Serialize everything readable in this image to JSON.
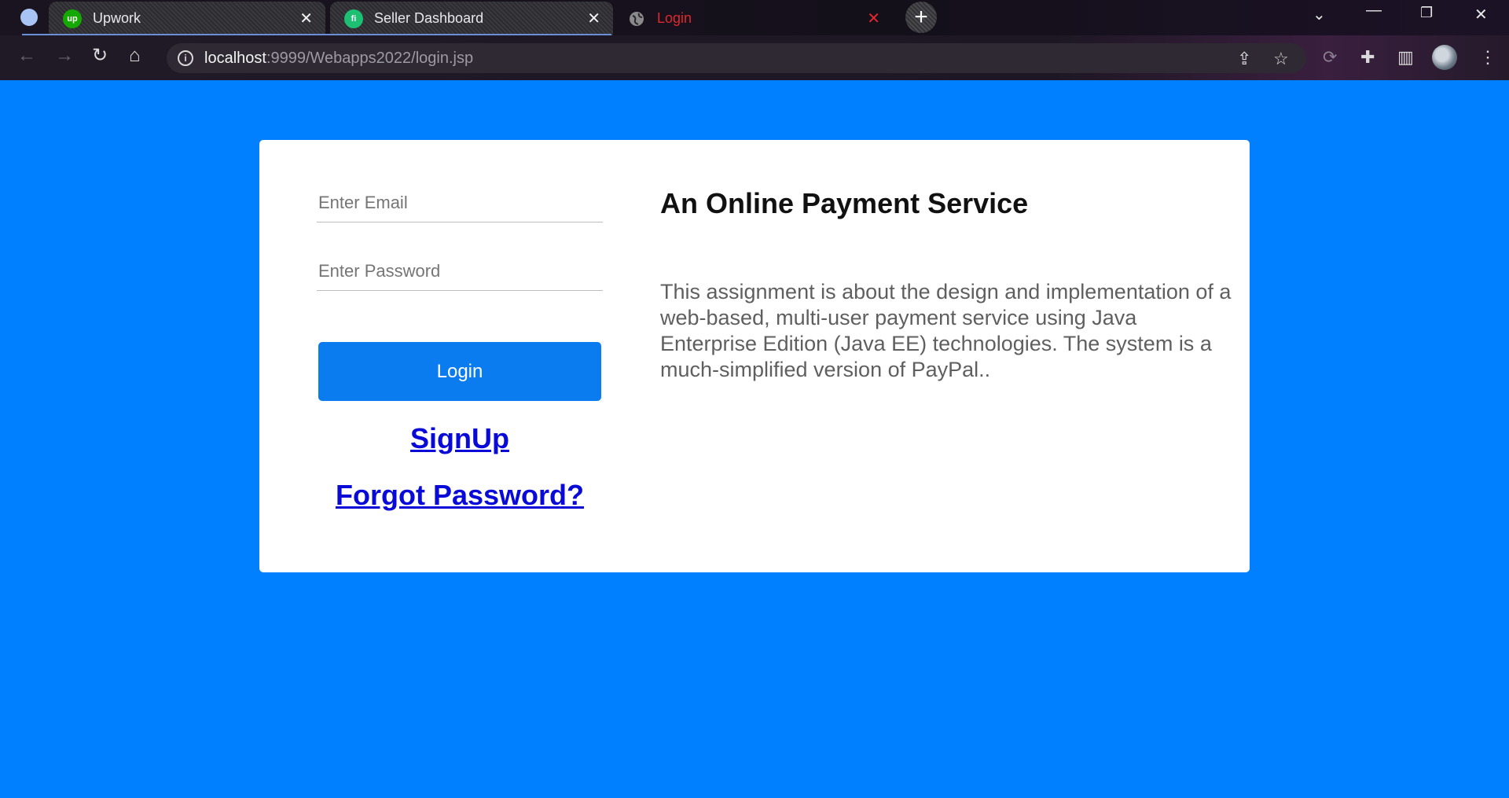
{
  "browser": {
    "tabs": [
      {
        "label": "Upwork",
        "favicon_text": "up",
        "favicon_color": "#14a800"
      },
      {
        "label": "Seller Dashboard",
        "favicon_text": "fi",
        "favicon_color": "#1dbf73"
      },
      {
        "label": "Login",
        "favicon_color": "#888888"
      }
    ],
    "url": {
      "host": "localhost",
      "rest": ":9999/Webapps2022/login.jsp"
    },
    "active_tab_color": "#e0282e"
  },
  "page": {
    "background": "#0080ff",
    "login_form": {
      "email_placeholder": "Enter Email",
      "password_placeholder": "Enter Password",
      "login_label": "Login",
      "signup_label": "SignUp",
      "forgot_label": "Forgot Password?"
    },
    "info": {
      "title": "An Online Payment Service",
      "description": "This assignment is about the design and implementation of a web-based, multi-user payment service using Java Enterprise Edition (Java EE) technologies. The system is a much-simplified version of PayPal.."
    }
  }
}
